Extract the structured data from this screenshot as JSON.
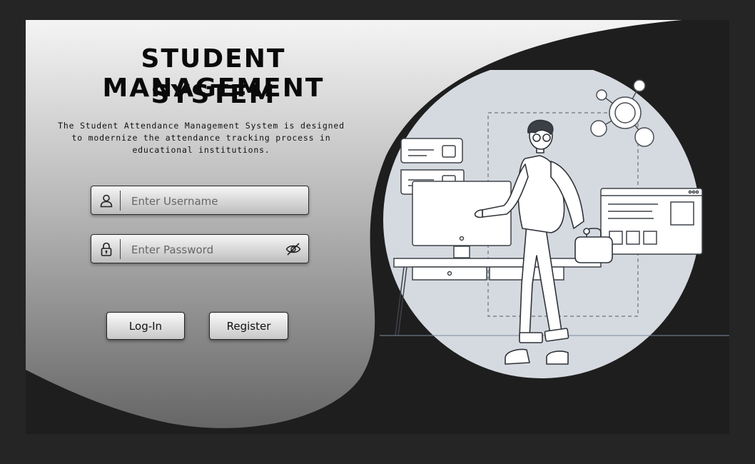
{
  "header": {
    "title_line1": "STUDENT MANAGEMENT",
    "title_line2": "SYSTEM",
    "description": "The Student Attendance Management System is designed to modernize the attendance tracking process in educational institutions."
  },
  "form": {
    "username": {
      "placeholder": "Enter Username",
      "value": "",
      "icon": "user-icon"
    },
    "password": {
      "placeholder": "Enter Password",
      "value": "",
      "icon": "lock-icon",
      "toggle_icon": "eye-slash-icon"
    },
    "login_label": "Log-In",
    "register_label": "Register"
  },
  "theme": {
    "page_background": "#252525",
    "panel_gradient_top": "#f2f2f2",
    "panel_gradient_bottom": "#6a6a6a",
    "illustration_circle": "#d5dae0",
    "text_color": "#0a0a0a"
  }
}
